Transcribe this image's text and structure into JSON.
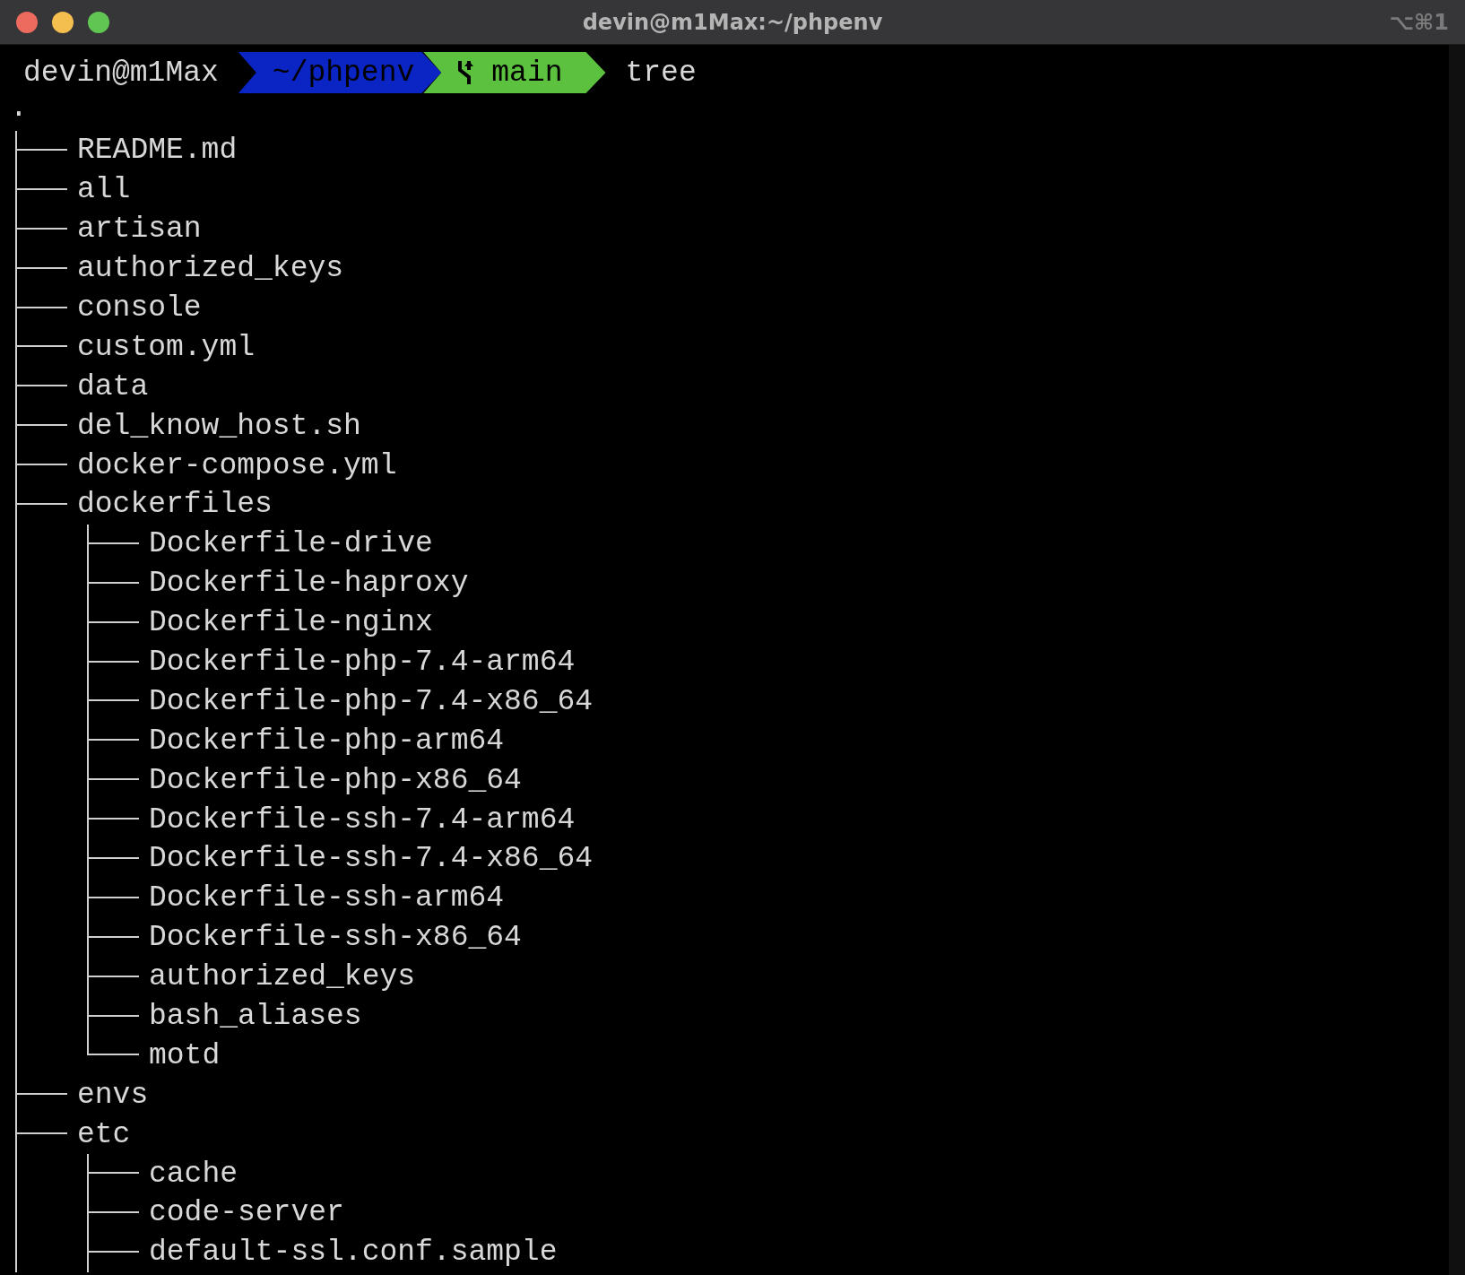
{
  "window": {
    "title": "devin@m1Max:~/phpenv",
    "shortcut": "⌥⌘1"
  },
  "prompt": {
    "user_host": "devin@m1Max",
    "path": "~/phpenv",
    "branch": "main",
    "command": "tree"
  },
  "tree": {
    "root": ".",
    "items": [
      {
        "name": "README.md",
        "last": false
      },
      {
        "name": "all",
        "last": false
      },
      {
        "name": "artisan",
        "last": false
      },
      {
        "name": "authorized_keys",
        "last": false
      },
      {
        "name": "console",
        "last": false
      },
      {
        "name": "custom.yml",
        "last": false
      },
      {
        "name": "data",
        "last": false
      },
      {
        "name": "del_know_host.sh",
        "last": false
      },
      {
        "name": "docker-compose.yml",
        "last": false
      },
      {
        "name": "dockerfiles",
        "last": false,
        "children": [
          {
            "name": "Dockerfile-drive",
            "last": false
          },
          {
            "name": "Dockerfile-haproxy",
            "last": false
          },
          {
            "name": "Dockerfile-nginx",
            "last": false
          },
          {
            "name": "Dockerfile-php-7.4-arm64",
            "last": false
          },
          {
            "name": "Dockerfile-php-7.4-x86_64",
            "last": false
          },
          {
            "name": "Dockerfile-php-arm64",
            "last": false
          },
          {
            "name": "Dockerfile-php-x86_64",
            "last": false
          },
          {
            "name": "Dockerfile-ssh-7.4-arm64",
            "last": false
          },
          {
            "name": "Dockerfile-ssh-7.4-x86_64",
            "last": false
          },
          {
            "name": "Dockerfile-ssh-arm64",
            "last": false
          },
          {
            "name": "Dockerfile-ssh-x86_64",
            "last": false
          },
          {
            "name": "authorized_keys",
            "last": false
          },
          {
            "name": "bash_aliases",
            "last": false
          },
          {
            "name": "motd",
            "last": true
          }
        ]
      },
      {
        "name": "envs",
        "last": false
      },
      {
        "name": "etc",
        "last": false,
        "children": [
          {
            "name": "cache",
            "last": false
          },
          {
            "name": "code-server",
            "last": false
          },
          {
            "name": "default-ssl.conf.sample",
            "last": false
          }
        ]
      }
    ]
  }
}
